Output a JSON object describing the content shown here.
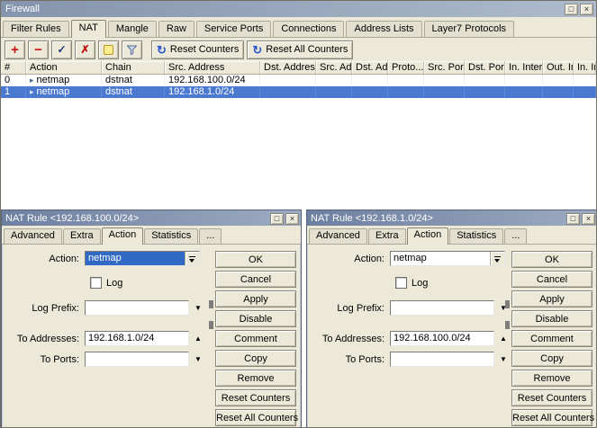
{
  "colors": {
    "selection_blue": "#4a79cf",
    "combo_selection_blue": "#316ac5",
    "window_bg": "#ece9d8",
    "titlebar_start": "#6e80a0",
    "titlebar_end": "#9dabc2"
  },
  "icons": {
    "add": "+",
    "remove": "−",
    "enable": "✓",
    "disable": "✗",
    "refresh": "↻",
    "dropdown": "▼",
    "collapse_up": "▲",
    "expand_down": "▼",
    "action_arrow": "▸",
    "restore": "□",
    "close": "×"
  },
  "window": {
    "title": "Firewall",
    "tabs": [
      "Filter Rules",
      "NAT",
      "Mangle",
      "Raw",
      "Service Ports",
      "Connections",
      "Address Lists",
      "Layer7 Protocols"
    ],
    "active_tab": "NAT"
  },
  "toolbar": {
    "reset_counters": "Reset Counters",
    "reset_all_counters": "Reset All Counters"
  },
  "table": {
    "columns": [
      "#",
      "Action",
      "Chain",
      "Src. Address",
      "Dst. Address",
      "Src. Ad...",
      "Dst. Ad...",
      "Proto...",
      "Src. Port",
      "Dst. Port",
      "In. Inter...",
      "Out. Int...",
      "In. Inte..."
    ],
    "rows": [
      {
        "id": "0",
        "action": "netmap",
        "chain": "dstnat",
        "src_address": "192.168.100.0/24"
      },
      {
        "id": "1",
        "action": "netmap",
        "chain": "dstnat",
        "src_address": "192.168.1.0/24"
      }
    ],
    "selected_row_index": 1
  },
  "dialog_left": {
    "title": "NAT Rule <192.168.100.0/24>",
    "tabs": [
      "Advanced",
      "Extra",
      "Action",
      "Statistics",
      "..."
    ],
    "active_tab": "Action",
    "action_label": "Action:",
    "action_value": "netmap",
    "log_label": "Log",
    "log_checked": false,
    "log_prefix_label": "Log Prefix:",
    "log_prefix_value": "",
    "to_addresses_label": "To Addresses:",
    "to_addresses_value": "192.168.1.0/24",
    "to_ports_label": "To Ports:",
    "to_ports_value": "",
    "buttons": [
      "OK",
      "Cancel",
      "Apply",
      "Disable",
      "Comment",
      "Copy",
      "Remove",
      "Reset Counters",
      "Reset All Counters"
    ]
  },
  "dialog_right": {
    "title": "NAT Rule <192.168.1.0/24>",
    "tabs": [
      "Advanced",
      "Extra",
      "Action",
      "Statistics",
      "..."
    ],
    "active_tab": "Action",
    "action_label": "Action:",
    "action_value": "netmap",
    "log_label": "Log",
    "log_checked": false,
    "log_prefix_label": "Log Prefix:",
    "log_prefix_value": "",
    "to_addresses_label": "To Addresses:",
    "to_addresses_value": "192.168.100.0/24",
    "to_ports_label": "To Ports:",
    "to_ports_value": "",
    "buttons": [
      "OK",
      "Cancel",
      "Apply",
      "Disable",
      "Comment",
      "Copy",
      "Remove",
      "Reset Counters",
      "Reset All Counters"
    ]
  }
}
